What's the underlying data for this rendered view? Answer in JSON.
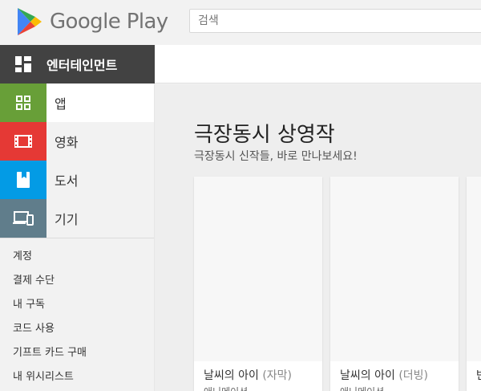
{
  "header": {
    "brand": "Google Play",
    "search_placeholder": "검색"
  },
  "category": {
    "label": "엔터테인먼트"
  },
  "nav": [
    {
      "label": "앱",
      "color": "#689f38"
    },
    {
      "label": "영화",
      "color": "#e53935"
    },
    {
      "label": "도서",
      "color": "#039be5"
    },
    {
      "label": "기기",
      "color": "#607d8b"
    }
  ],
  "account_links": [
    "계정",
    "결제 수단",
    "내 구독",
    "코드 사용",
    "기프트 카드 구매",
    "내 위시리스트"
  ],
  "section": {
    "title": "극장동시 상영작",
    "subtitle": "극장동시 신작들, 바로 만나보세요!"
  },
  "cards": [
    {
      "title": "날씨의 아이",
      "variant": "(자막)",
      "genre": "애니메이션"
    },
    {
      "title": "날씨의 아이",
      "variant": "(더빙)",
      "genre": "애니메이션"
    },
    {
      "title": "반",
      "variant": "",
      "genre": ""
    }
  ],
  "colors": {
    "category_dark": "#424242",
    "background": "#f2f2f2"
  },
  "icons": {
    "logo": "google-play-triangle-icon",
    "category": "entertainment-grid-icon",
    "apps": "apps-grid-icon",
    "movies": "film-icon",
    "books": "book-icon",
    "devices": "devices-icon"
  }
}
